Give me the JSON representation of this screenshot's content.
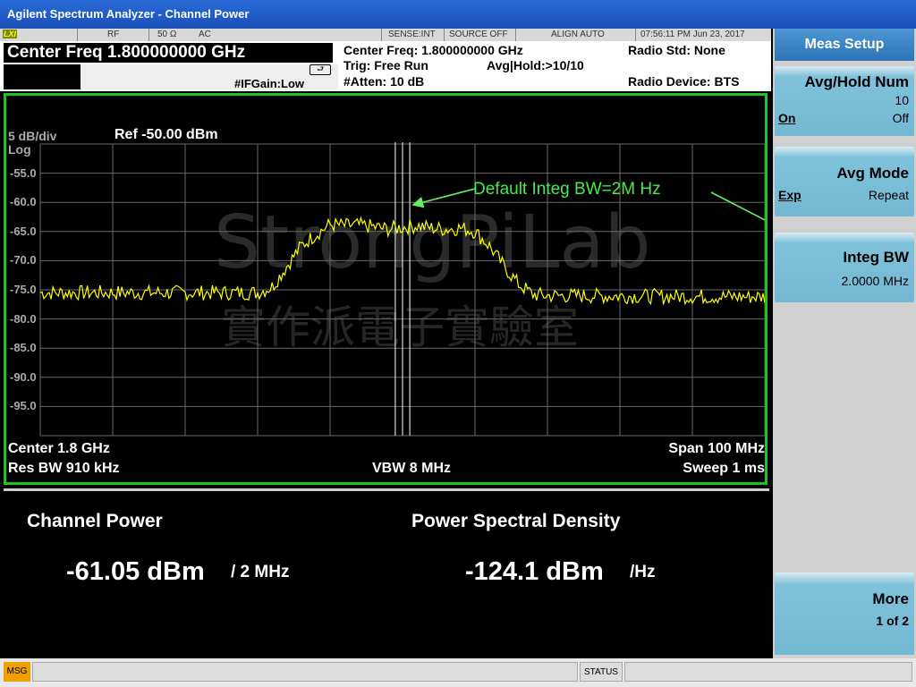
{
  "window": {
    "title": "Agilent Spectrum Analyzer - Channel Power"
  },
  "status_bar": {
    "lxi": "LXI",
    "rf": "RF",
    "impedance": "50 Ω",
    "coupling": "AC",
    "sense": "SENSE:INT",
    "source": "SOURCE OFF",
    "align": "ALIGN AUTO",
    "datetime": "07:56:11 PM Jun 23, 2017"
  },
  "header": {
    "active_function": "Center Freq 1.800000000 GHz",
    "ifgain": "#IFGain:Low",
    "center_freq": "Center Freq: 1.800000000 GHz",
    "trig": "Trig: Free Run",
    "avg_hold": "Avg|Hold:>10/10",
    "atten": "#Atten: 10 dB",
    "radio_std": "Radio Std: None",
    "radio_device": "Radio Device: BTS"
  },
  "graph": {
    "scale": "5 dB/div",
    "scale_type": "Log",
    "ref_level": "Ref -50.00 dBm",
    "y_labels": [
      "-55.0",
      "-60.0",
      "-65.0",
      "-70.0",
      "-75.0",
      "-80.0",
      "-85.0",
      "-90.0",
      "-95.0"
    ],
    "annotation": "Default Integ BW=2M Hz",
    "center": "Center  1.8 GHz",
    "res_bw": "Res BW  910 kHz",
    "vbw": "VBW  8 MHz",
    "span": "Span 100 MHz",
    "sweep": "Sweep   1 ms",
    "trace_color": "#ffff00",
    "watermark_latin": "StrongPiLab",
    "watermark_cjk": "實作派電子實驗室"
  },
  "chart_data": {
    "type": "line",
    "title": "",
    "xlabel": "",
    "ylabel": "",
    "x_unit": "MHz offset from center",
    "y_unit": "dBm",
    "xlim": [
      -50,
      50
    ],
    "ylim": [
      -100,
      -50
    ],
    "series": [
      {
        "x": [
          -50,
          -20,
          -18,
          -16,
          -14,
          -12,
          -10,
          -8,
          -6,
          -4,
          -2,
          0,
          2,
          4,
          6,
          8,
          10,
          12,
          14,
          16,
          18,
          20,
          50
        ],
        "y": [
          -75.5,
          -75.5,
          -74.5,
          -71,
          -67.5,
          -65.5,
          -63.8,
          -64,
          -63.9,
          -64.2,
          -64.6,
          -64.3,
          -64,
          -64.4,
          -64.6,
          -64.4,
          -65,
          -67.5,
          -71,
          -74,
          -75.8,
          -76,
          -76.2
        ]
      }
    ]
  },
  "results": {
    "channel_power_label": "Channel Power",
    "channel_power_value": "-61.05 dBm",
    "channel_power_unit": "/ 2 MHz",
    "psd_label": "Power Spectral Density",
    "psd_value": "-124.1 dBm",
    "psd_unit": "/Hz"
  },
  "softkeys": {
    "menu_title": "Meas Setup",
    "avg_hold_label": "Avg/Hold Num",
    "avg_hold_value": "10",
    "avg_hold_on": "On",
    "avg_hold_off": "Off",
    "avg_mode_label": "Avg Mode",
    "avg_mode_exp": "Exp",
    "avg_mode_repeat": "Repeat",
    "integ_bw_label": "Integ BW",
    "integ_bw_value": "2.0000 MHz",
    "more_label": "More",
    "more_page": "1 of 2"
  },
  "bottom_bar": {
    "msg": "MSG",
    "status": "STATUS"
  }
}
